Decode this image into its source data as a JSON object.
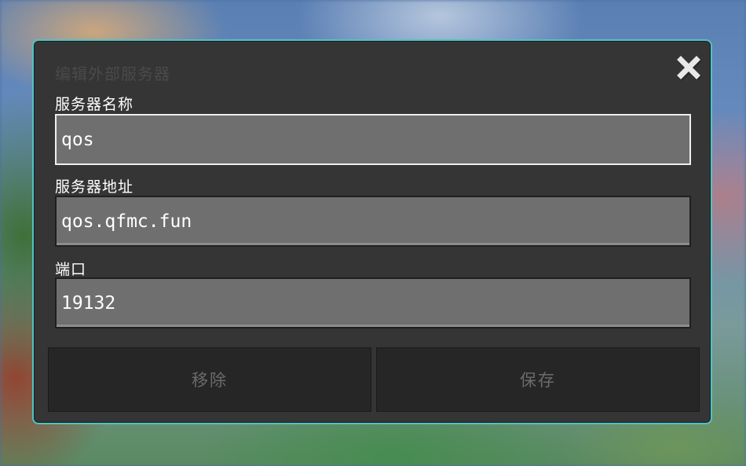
{
  "dialog": {
    "title": "编辑外部服务器",
    "close_icon": "close-icon"
  },
  "fields": {
    "name_label": "服务器名称",
    "name_value": "qos",
    "address_label": "服务器地址",
    "address_value": "qos.qfmc.fun",
    "port_label": "端口",
    "port_value": "19132"
  },
  "buttons": {
    "remove_label": "移除",
    "save_label": "保存"
  },
  "colors": {
    "accent_border": "#4fc3c6",
    "panel": "#353535",
    "field": "#6f6f6f"
  }
}
